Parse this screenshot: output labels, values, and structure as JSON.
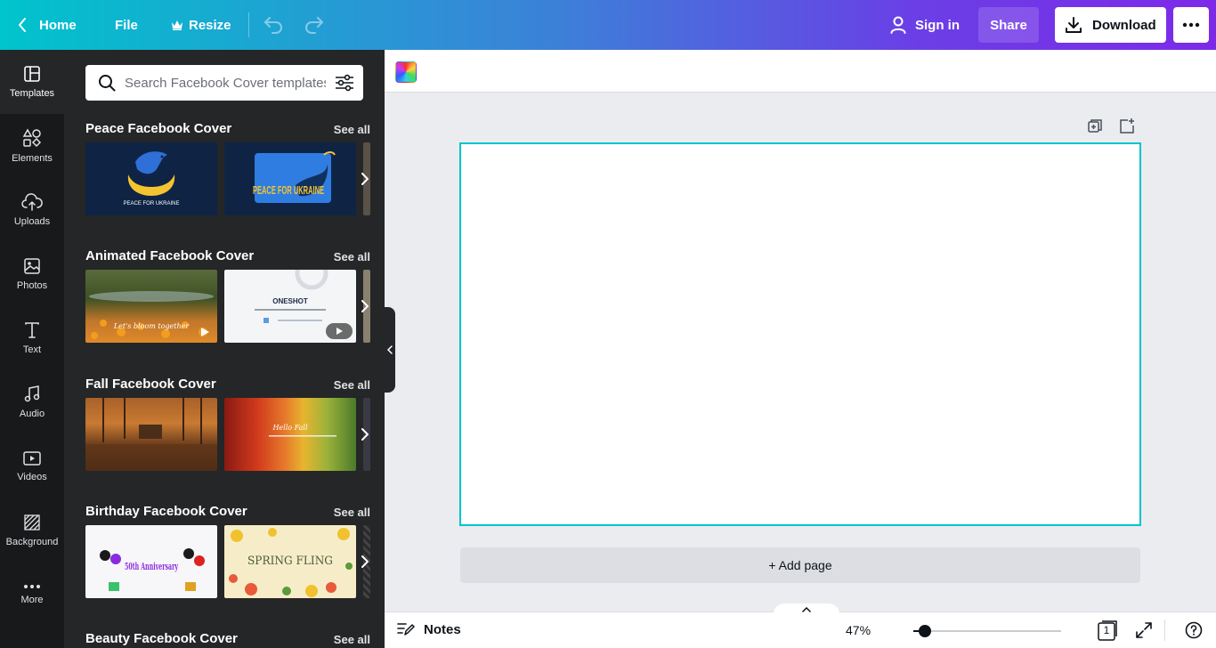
{
  "topbar": {
    "home": "Home",
    "file": "File",
    "resize": "Resize",
    "signin": "Sign in",
    "share": "Share",
    "download": "Download"
  },
  "rail": {
    "items": [
      {
        "label": "Templates",
        "icon": "templates-icon"
      },
      {
        "label": "Elements",
        "icon": "elements-icon"
      },
      {
        "label": "Uploads",
        "icon": "uploads-icon"
      },
      {
        "label": "Photos",
        "icon": "photos-icon"
      },
      {
        "label": "Text",
        "icon": "text-icon"
      },
      {
        "label": "Audio",
        "icon": "audio-icon"
      },
      {
        "label": "Videos",
        "icon": "videos-icon"
      },
      {
        "label": "Background",
        "icon": "background-icon"
      },
      {
        "label": "More",
        "icon": "more-icon"
      }
    ]
  },
  "search": {
    "placeholder": "Search Facebook Cover templates"
  },
  "sections": [
    {
      "title": "Peace Facebook Cover",
      "see_all": "See all",
      "thumb_texts": [
        "PEACE FOR UKRAINE",
        "PEACE FOR UKRAINE"
      ]
    },
    {
      "title": "Animated Facebook Cover",
      "see_all": "See all",
      "thumb_texts": [
        "Let's bloom together",
        "ONESHOT"
      ]
    },
    {
      "title": "Fall Facebook Cover",
      "see_all": "See all",
      "thumb_texts": [
        "",
        "Hello Fall"
      ]
    },
    {
      "title": "Birthday Facebook Cover",
      "see_all": "See all",
      "thumb_texts": [
        "50th Anniversary",
        "SPRING FLING"
      ]
    },
    {
      "title": "Beauty Facebook Cover",
      "see_all": "See all"
    }
  ],
  "canvas": {
    "add_page": "+ Add page"
  },
  "bottom": {
    "notes": "Notes",
    "zoom": "47%",
    "zoom_value": 47,
    "page_count": "1"
  },
  "colors": {
    "accent": "#00c4cc",
    "brand_purple": "#7d2ae8",
    "panel": "#252627",
    "rail": "#18191b"
  }
}
